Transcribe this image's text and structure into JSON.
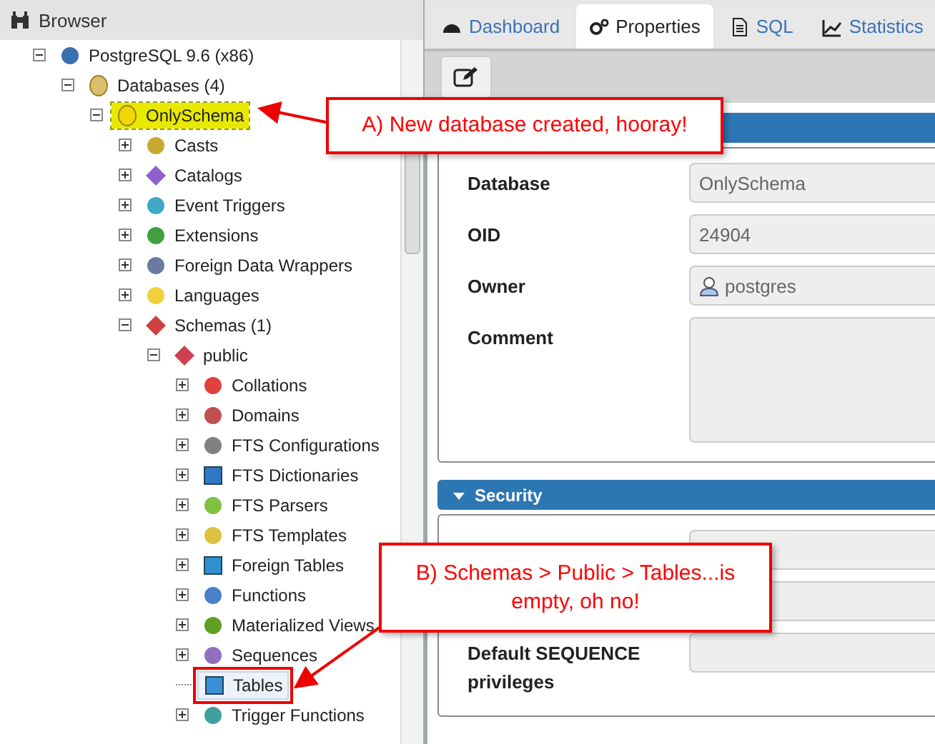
{
  "browser": {
    "title": "Browser",
    "tree": [
      {
        "label": "PostgreSQL 9.6 (x86)",
        "kind": "server",
        "expanded": true,
        "selected": false,
        "children": [
          {
            "label": "Databases (4)",
            "kind": "databases",
            "expanded": true,
            "selected": false,
            "children": [
              {
                "label": "OnlySchema",
                "kind": "database",
                "expanded": true,
                "selected": true,
                "children": [
                  {
                    "label": "Casts",
                    "kind": "casts",
                    "expanded": false,
                    "selected": false
                  },
                  {
                    "label": "Catalogs",
                    "kind": "catalogs",
                    "expanded": false,
                    "selected": false
                  },
                  {
                    "label": "Event Triggers",
                    "kind": "triggers",
                    "expanded": false,
                    "selected": false
                  },
                  {
                    "label": "Extensions",
                    "kind": "extensions",
                    "expanded": false,
                    "selected": false
                  },
                  {
                    "label": "Foreign Data Wrappers",
                    "kind": "fdw",
                    "expanded": false,
                    "selected": false
                  },
                  {
                    "label": "Languages",
                    "kind": "languages",
                    "expanded": false,
                    "selected": false
                  },
                  {
                    "label": "Schemas (1)",
                    "kind": "schemas",
                    "expanded": true,
                    "selected": false,
                    "children": [
                      {
                        "label": "public",
                        "kind": "schema",
                        "expanded": true,
                        "selected": false,
                        "children": [
                          {
                            "label": "Collations",
                            "kind": "collations",
                            "expanded": false,
                            "selected": false
                          },
                          {
                            "label": "Domains",
                            "kind": "domains",
                            "expanded": false,
                            "selected": false
                          },
                          {
                            "label": "FTS Configurations",
                            "kind": "fts_config",
                            "expanded": false,
                            "selected": false
                          },
                          {
                            "label": "FTS Dictionaries",
                            "kind": "fts_dict",
                            "expanded": false,
                            "selected": false
                          },
                          {
                            "label": "FTS Parsers",
                            "kind": "fts_parser",
                            "expanded": false,
                            "selected": false
                          },
                          {
                            "label": "FTS Templates",
                            "kind": "fts_template",
                            "expanded": false,
                            "selected": false
                          },
                          {
                            "label": "Foreign Tables",
                            "kind": "foreign_tables",
                            "expanded": false,
                            "selected": false
                          },
                          {
                            "label": "Functions",
                            "kind": "functions",
                            "expanded": false,
                            "selected": false
                          },
                          {
                            "label": "Materialized Views",
                            "kind": "mviews",
                            "expanded": false,
                            "selected": false
                          },
                          {
                            "label": "Sequences",
                            "kind": "sequences",
                            "expanded": false,
                            "selected": false
                          },
                          {
                            "label": "Tables",
                            "kind": "tables",
                            "selected": false
                          },
                          {
                            "label": "Trigger Functions",
                            "kind": "trigger_functions",
                            "expanded": false,
                            "selected": false
                          }
                        ]
                      }
                    ]
                  }
                ]
              }
            ]
          }
        ]
      }
    ]
  },
  "tabs": [
    {
      "label": "Dashboard",
      "kind": "dashboard",
      "selected": false
    },
    {
      "label": "Properties",
      "kind": "properties",
      "selected": true
    },
    {
      "label": "SQL",
      "kind": "sql",
      "selected": false
    },
    {
      "label": "Statistics",
      "kind": "statistics",
      "selected": false
    }
  ],
  "general": {
    "fields": [
      {
        "label": "Database",
        "value": "OnlySchema",
        "kind": "text"
      },
      {
        "label": "OID",
        "value": "24904",
        "kind": "text"
      },
      {
        "label": "Owner",
        "value": "postgres",
        "kind": "user"
      },
      {
        "label": "Comment",
        "kind": "textarea"
      }
    ]
  },
  "security": {
    "title": "Security",
    "expanded": true,
    "fields": [
      {
        "label": "Default SEQUENCE privileges",
        "kind": "text"
      }
    ]
  },
  "callouts": [
    {
      "text": "A) New database created, hooray!"
    },
    {
      "text": "B) Schemas > Public > Tables...is empty, oh no!"
    }
  ]
}
